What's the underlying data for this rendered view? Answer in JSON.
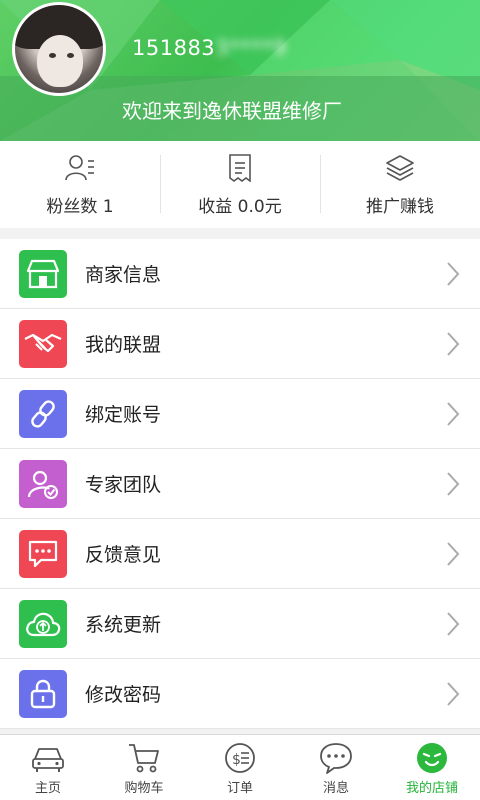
{
  "header": {
    "phone_visible": "151883",
    "phone_obscured": "3****9",
    "welcome": "欢迎来到逸休联盟维修厂"
  },
  "stats": [
    {
      "icon": "fans-icon",
      "label": "粉丝数 1"
    },
    {
      "icon": "receipt-icon",
      "label": "收益 0.0元"
    },
    {
      "icon": "layers-icon",
      "label": "推广赚钱"
    }
  ],
  "menu": [
    {
      "icon": "store-icon",
      "label": "商家信息",
      "color": "#2fbf4f"
    },
    {
      "icon": "handshake-icon",
      "label": "我的联盟",
      "color": "#ef4753"
    },
    {
      "icon": "link-icon",
      "label": "绑定账号",
      "color": "#6b71ea"
    },
    {
      "icon": "expert-icon",
      "label": "专家团队",
      "color": "#c45fcf"
    },
    {
      "icon": "feedback-icon",
      "label": "反馈意见",
      "color": "#ef4753"
    },
    {
      "icon": "cloud-upload-icon",
      "label": "系统更新",
      "color": "#2fbf4f"
    },
    {
      "icon": "lock-icon",
      "label": "修改密码",
      "color": "#6b71ea"
    }
  ],
  "nav": [
    {
      "icon": "car-icon",
      "label": "主页",
      "active": false
    },
    {
      "icon": "cart-icon",
      "label": "购物车",
      "active": false
    },
    {
      "icon": "order-icon",
      "label": "订单",
      "active": false
    },
    {
      "icon": "message-icon",
      "label": "消息",
      "active": false
    },
    {
      "icon": "my-store-icon",
      "label": "我的店铺",
      "active": true
    }
  ],
  "colors": {
    "accent": "#25b339",
    "header_green": "#3ebd4f"
  }
}
